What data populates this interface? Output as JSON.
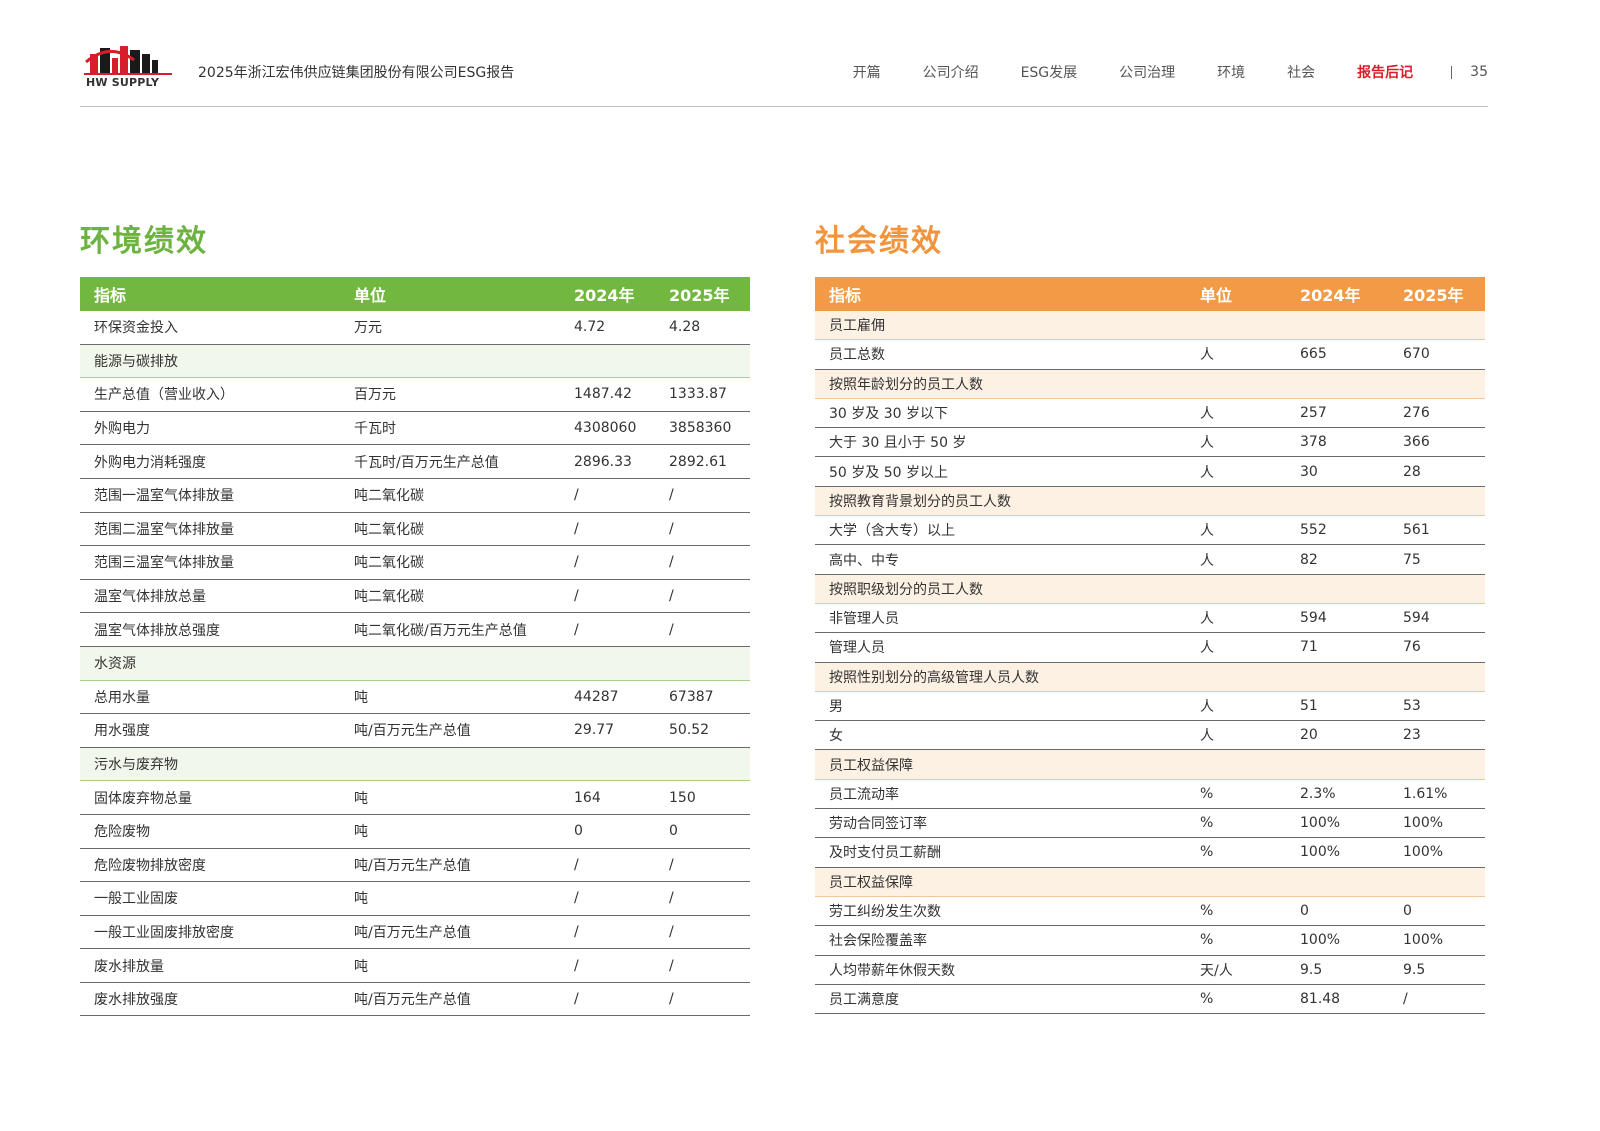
{
  "header": {
    "logo_text": "HW SUPPLY",
    "report_title": "2025年浙江宏伟供应链集团股份有限公司ESG报告",
    "nav": [
      "开篇",
      "公司介绍",
      "ESG发展",
      "公司治理",
      "环境",
      "社会",
      "报告后记"
    ],
    "active_nav": "报告后记",
    "page_number": "35"
  },
  "colors": {
    "env_accent": "#72b73f",
    "soc_accent": "#f29a45",
    "nav_active": "#d71f2b"
  },
  "env": {
    "title": "环境绩效",
    "headers": [
      "指标",
      "单位",
      "2024年",
      "2025年"
    ],
    "rows": [
      {
        "type": "data",
        "name": "环保资金投入",
        "unit": "万元",
        "y2024": "4.72",
        "y2025": "4.28"
      },
      {
        "type": "group",
        "name": "能源与碳排放"
      },
      {
        "type": "data",
        "name": "生产总值（营业收入）",
        "unit": "百万元",
        "y2024": "1487.42",
        "y2025": "1333.87"
      },
      {
        "type": "data",
        "name": "外购电力",
        "unit": "千瓦时",
        "y2024": "4308060",
        "y2025": "3858360"
      },
      {
        "type": "data",
        "name": "外购电力消耗强度",
        "unit": "千瓦时/百万元生产总值",
        "y2024": "2896.33",
        "y2025": "2892.61"
      },
      {
        "type": "data",
        "name": "范围一温室气体排放量",
        "unit": "吨二氧化碳",
        "y2024": "/",
        "y2025": "/"
      },
      {
        "type": "data",
        "name": "范围二温室气体排放量",
        "unit": "吨二氧化碳",
        "y2024": "/",
        "y2025": "/"
      },
      {
        "type": "data",
        "name": "范围三温室气体排放量",
        "unit": "吨二氧化碳",
        "y2024": "/",
        "y2025": "/"
      },
      {
        "type": "data",
        "name": "温室气体排放总量",
        "unit": "吨二氧化碳",
        "y2024": "/",
        "y2025": "/"
      },
      {
        "type": "data",
        "name": "温室气体排放总强度",
        "unit": "吨二氧化碳/百万元生产总值",
        "y2024": "/",
        "y2025": "/"
      },
      {
        "type": "group",
        "name": "水资源"
      },
      {
        "type": "data",
        "name": "总用水量",
        "unit": "吨",
        "y2024": "44287",
        "y2025": "67387"
      },
      {
        "type": "data",
        "name": "用水强度",
        "unit": "吨/百万元生产总值",
        "y2024": "29.77",
        "y2025": "50.52"
      },
      {
        "type": "group",
        "name": "污水与废弃物"
      },
      {
        "type": "data",
        "name": "固体废弃物总量",
        "unit": "吨",
        "y2024": "164",
        "y2025": "150"
      },
      {
        "type": "data",
        "name": "危险废物",
        "unit": "吨",
        "y2024": "0",
        "y2025": "0"
      },
      {
        "type": "data",
        "name": "危险废物排放密度",
        "unit": "吨/百万元生产总值",
        "y2024": "/",
        "y2025": "/"
      },
      {
        "type": "data",
        "name": "一般工业固废",
        "unit": "吨",
        "y2024": "/",
        "y2025": "/"
      },
      {
        "type": "data",
        "name": "一般工业固废排放密度",
        "unit": "吨/百万元生产总值",
        "y2024": "/",
        "y2025": "/"
      },
      {
        "type": "data",
        "name": "废水排放量",
        "unit": "吨",
        "y2024": "/",
        "y2025": "/"
      },
      {
        "type": "data",
        "name": "废水排放强度",
        "unit": "吨/百万元生产总值",
        "y2024": "/",
        "y2025": "/"
      }
    ]
  },
  "soc": {
    "title": "社会绩效",
    "headers": [
      "指标",
      "单位",
      "2024年",
      "2025年"
    ],
    "rows": [
      {
        "type": "group",
        "name": "员工雇佣"
      },
      {
        "type": "data",
        "name": "员工总数",
        "unit": "人",
        "y2024": "665",
        "y2025": "670"
      },
      {
        "type": "group",
        "name": "按照年龄划分的员工人数"
      },
      {
        "type": "data",
        "name": "30 岁及 30 岁以下",
        "unit": "人",
        "y2024": "257",
        "y2025": "276"
      },
      {
        "type": "data",
        "name": "大于 30 且小于 50 岁",
        "unit": "人",
        "y2024": "378",
        "y2025": "366"
      },
      {
        "type": "data",
        "name": "50 岁及 50 岁以上",
        "unit": "人",
        "y2024": "30",
        "y2025": "28"
      },
      {
        "type": "group",
        "name": "按照教育背景划分的员工人数"
      },
      {
        "type": "data",
        "name": "大学（含大专）以上",
        "unit": "人",
        "y2024": "552",
        "y2025": "561"
      },
      {
        "type": "data",
        "name": "高中、中专",
        "unit": "人",
        "y2024": "82",
        "y2025": "75"
      },
      {
        "type": "group",
        "name": "按照职级划分的员工人数"
      },
      {
        "type": "data",
        "name": "非管理人员",
        "unit": "人",
        "y2024": "594",
        "y2025": "594"
      },
      {
        "type": "data",
        "name": "管理人员",
        "unit": "人",
        "y2024": "71",
        "y2025": "76"
      },
      {
        "type": "group",
        "name": "按照性别划分的高级管理人员人数"
      },
      {
        "type": "data",
        "name": "男",
        "unit": "人",
        "y2024": "51",
        "y2025": "53"
      },
      {
        "type": "data",
        "name": "女",
        "unit": "人",
        "y2024": "20",
        "y2025": "23"
      },
      {
        "type": "group",
        "name": "员工权益保障"
      },
      {
        "type": "data",
        "name": "员工流动率",
        "unit": "%",
        "y2024": "2.3%",
        "y2025": "1.61%"
      },
      {
        "type": "data",
        "name": "劳动合同签订率",
        "unit": "%",
        "y2024": "100%",
        "y2025": "100%"
      },
      {
        "type": "data",
        "name": "及时支付员工薪酬",
        "unit": "%",
        "y2024": "100%",
        "y2025": "100%"
      },
      {
        "type": "group",
        "name": "员工权益保障"
      },
      {
        "type": "data",
        "name": "劳工纠纷发生次数",
        "unit": "%",
        "y2024": "0",
        "y2025": "0"
      },
      {
        "type": "data",
        "name": "社会保险覆盖率",
        "unit": "%",
        "y2024": "100%",
        "y2025": "100%"
      },
      {
        "type": "data",
        "name": "人均带薪年休假天数",
        "unit": "天/人",
        "y2024": "9.5",
        "y2025": "9.5"
      },
      {
        "type": "data",
        "name": "员工满意度",
        "unit": "%",
        "y2024": "81.48",
        "y2025": "/"
      }
    ]
  }
}
